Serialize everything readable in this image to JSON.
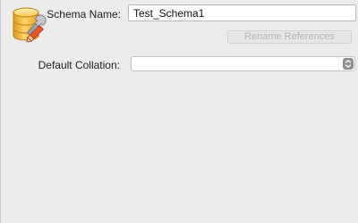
{
  "form": {
    "schema_name_label": "Schema Name:",
    "schema_name_value": "Test_Schema1",
    "rename_references_label": "Rename References",
    "default_collation_label": "Default Collation:",
    "default_collation_value": ""
  },
  "icons": {
    "schema": "database-schema-icon",
    "stepper": "chevron-up-down-icon"
  },
  "colors": {
    "background": "#ececec",
    "input_background": "#ffffff",
    "disabled_text": "#b2b2b2",
    "database_icon": "#f0b232"
  }
}
